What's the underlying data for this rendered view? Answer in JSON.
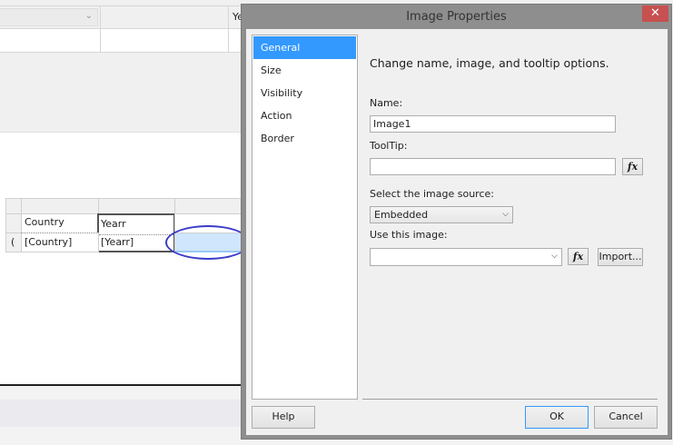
{
  "background": {
    "column_header_partial": "Ye",
    "table": {
      "header_row": [
        "Country",
        "Yearr"
      ],
      "detail_row": [
        "[Country]",
        "[Yearr]"
      ],
      "row_marker": "("
    }
  },
  "dialog": {
    "title": "Image Properties",
    "close_label": "✕",
    "nav": [
      "General",
      "Size",
      "Visibility",
      "Action",
      "Border"
    ],
    "selected_nav": "General",
    "heading": "Change name, image, and tooltip options.",
    "name_label": "Name:",
    "name_value": "Image1",
    "tooltip_label": "ToolTip:",
    "tooltip_value": "",
    "fx_label": "fx",
    "source_label": "Select the image source:",
    "source_value": "Embedded",
    "use_image_label": "Use this image:",
    "use_image_value": "",
    "import_label": "Import...",
    "help_label": "Help",
    "ok_label": "OK",
    "cancel_label": "Cancel"
  },
  "colors": {
    "selection": "#3399ff",
    "close": "#c75050",
    "annotation": "#3c3cc8"
  }
}
